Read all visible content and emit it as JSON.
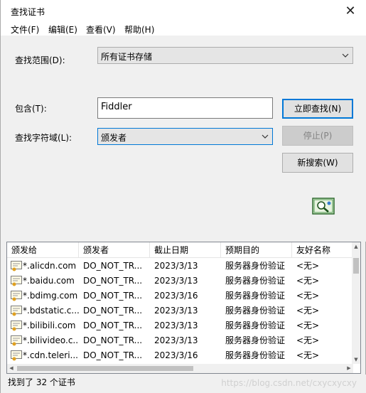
{
  "window": {
    "title": "查找证书",
    "close_glyph": "✕"
  },
  "menu": [
    {
      "label": "文件(F)"
    },
    {
      "label": "编辑(E)"
    },
    {
      "label": "查看(V)"
    },
    {
      "label": "帮助(H)"
    }
  ],
  "search": {
    "scope_label": "查找范围(D):",
    "scope_value": "所有证书存储",
    "contains_label": "包含(T):",
    "contains_value": "Fiddler",
    "field_label": "查找字符域(L):",
    "field_value": "颁发者"
  },
  "buttons": {
    "find_now": "立即查找(N)",
    "stop": "停止(P)",
    "new_search": "新搜索(W)"
  },
  "table": {
    "columns": [
      "颁发给",
      "颁发者",
      "截止日期",
      "预期目的",
      "友好名称"
    ],
    "rows": [
      {
        "issued_to": "*.alicdn.com",
        "issued_by": "DO_NOT_TR...",
        "expiry": "2023/3/13",
        "purpose": "服务器身份验证",
        "friendly_name": "<无>"
      },
      {
        "issued_to": "*.baidu.com",
        "issued_by": "DO_NOT_TR...",
        "expiry": "2023/3/13",
        "purpose": "服务器身份验证",
        "friendly_name": "<无>"
      },
      {
        "issued_to": "*.bdimg.com",
        "issued_by": "DO_NOT_TR...",
        "expiry": "2023/3/16",
        "purpose": "服务器身份验证",
        "friendly_name": "<无>"
      },
      {
        "issued_to": "*.bdstatic.c...",
        "issued_by": "DO_NOT_TR...",
        "expiry": "2023/3/13",
        "purpose": "服务器身份验证",
        "friendly_name": "<无>"
      },
      {
        "issued_to": "*.bilibili.com",
        "issued_by": "DO_NOT_TR...",
        "expiry": "2023/3/13",
        "purpose": "服务器身份验证",
        "friendly_name": "<无>"
      },
      {
        "issued_to": "*.bilivideo.c...",
        "issued_by": "DO_NOT_TR...",
        "expiry": "2023/3/13",
        "purpose": "服务器身份验证",
        "friendly_name": "<无>"
      },
      {
        "issued_to": "*.cdn.teleri...",
        "issued_by": "DO_NOT_TR...",
        "expiry": "2023/3/16",
        "purpose": "服务器身份验证",
        "friendly_name": "<无>"
      }
    ]
  },
  "status": {
    "text": "找到了 32 个证书"
  },
  "watermark": "https://blog.csdn.net/cxycxycxy"
}
